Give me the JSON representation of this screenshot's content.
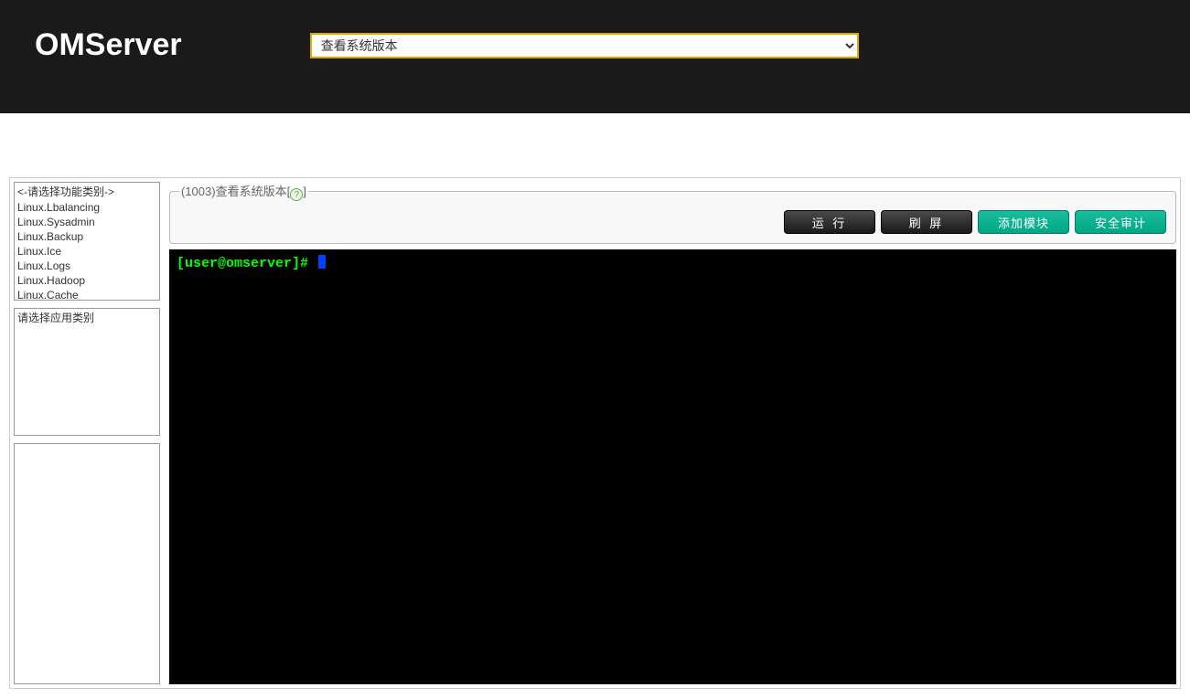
{
  "header": {
    "title": "OMServer",
    "select_value": "查看系统版本"
  },
  "sidebar": {
    "category_list": {
      "items": [
        "<-请选择功能类别->",
        "Linux.Lbalancing",
        "Linux.Sysadmin",
        "Linux.Backup",
        "Linux.Ice",
        "Linux.Logs",
        "Linux.Hadoop",
        "Linux.Cache"
      ]
    },
    "app_list": {
      "items": [
        "请选择应用类别"
      ]
    },
    "third_list": {
      "items": []
    }
  },
  "panel": {
    "legend_prefix": "(1003)",
    "legend_title": "查看系统版本",
    "legend_open": "[",
    "legend_close": "]",
    "help_symbol": "?",
    "buttons": {
      "run": "运 行",
      "refresh": "刷 屏",
      "add_module": "添加模块",
      "audit": "安全审计"
    }
  },
  "terminal": {
    "prompt": "[user@omserver]# "
  }
}
